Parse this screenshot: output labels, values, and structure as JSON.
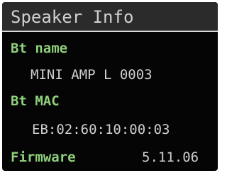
{
  "header": {
    "title": "Speaker Info"
  },
  "bt_name": {
    "label": "Bt name",
    "value": "MINI AMP L 0003"
  },
  "bt_mac": {
    "label": "Bt MAC",
    "value": "EB:02:60:10:00:03"
  },
  "firmware": {
    "label": "Firmware",
    "value": "5.11.06"
  },
  "colors": {
    "background": "#050505",
    "header_background": "#2b2b2b",
    "label": "#8fd07c",
    "value": "#cfcfcf"
  }
}
